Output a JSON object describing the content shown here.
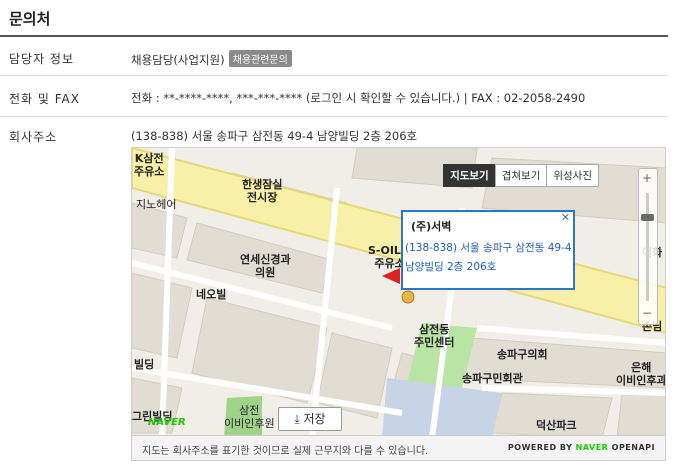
{
  "page": {
    "title": "문의처"
  },
  "rows": [
    {
      "label": "담당자 정보",
      "value": "채용담당(사업지원)",
      "badge": "채용관련문의"
    },
    {
      "label": "전화 및 FAX",
      "value": "전화 : **-****-****, ***-***-**** (로그인 시 확인할 수 있습니다.) | FAX : 02-2058-2490"
    },
    {
      "label": "회사주소",
      "value": "(138-838) 서울 송파구 삼전동 49-4 남양빌딩 2층 206호"
    }
  ],
  "map": {
    "tabs": [
      {
        "label": "지도보기",
        "active": true
      },
      {
        "label": "겹쳐보기",
        "active": false
      },
      {
        "label": "위성사진",
        "active": false
      }
    ],
    "places": {
      "k_sam": "K삼전\n주유소",
      "hansaeng": "한생잠실\n전시장",
      "jinohei": "지노헤어",
      "yeonse": "연세신경과\n의원",
      "neobil": "네오빌",
      "soil": "S-OIL송\n주유소",
      "samjeon_center": "삼전동\n주민센터",
      "songpa_council": "송파구의회",
      "songpa_hall": "송파구민회관",
      "bank": "은해\n이비인후과",
      "deoksan": "덕산파크",
      "edge_right": "이화",
      "edge_right2": "손님",
      "bil": "빌딩",
      "grand": "그린빌딩",
      "samjeon_clinic": "삼전\n이비인후원"
    },
    "popup": {
      "title": "(주)서벽",
      "address": "(138-838) 서울 송파구 삼전동 49-4 남양빌딩 2층 206호"
    },
    "save_label": "저장",
    "naver_logo": "NAVER",
    "notice": "지도는 회사주소를 표기한 것이므로 실제 근무지와 다를 수 있습니다.",
    "powered_prefix": "POWERED BY",
    "powered_brand": "NAVER",
    "powered_suffix": "OPENAPI",
    "zoom_level_fraction": 0.22
  },
  "colors": {
    "road_main": "#f8f0a8",
    "road_edge": "#e7d97a",
    "block": "#e2ddd3",
    "park": "#9fd38a",
    "popup_border": "#2b77c5"
  }
}
